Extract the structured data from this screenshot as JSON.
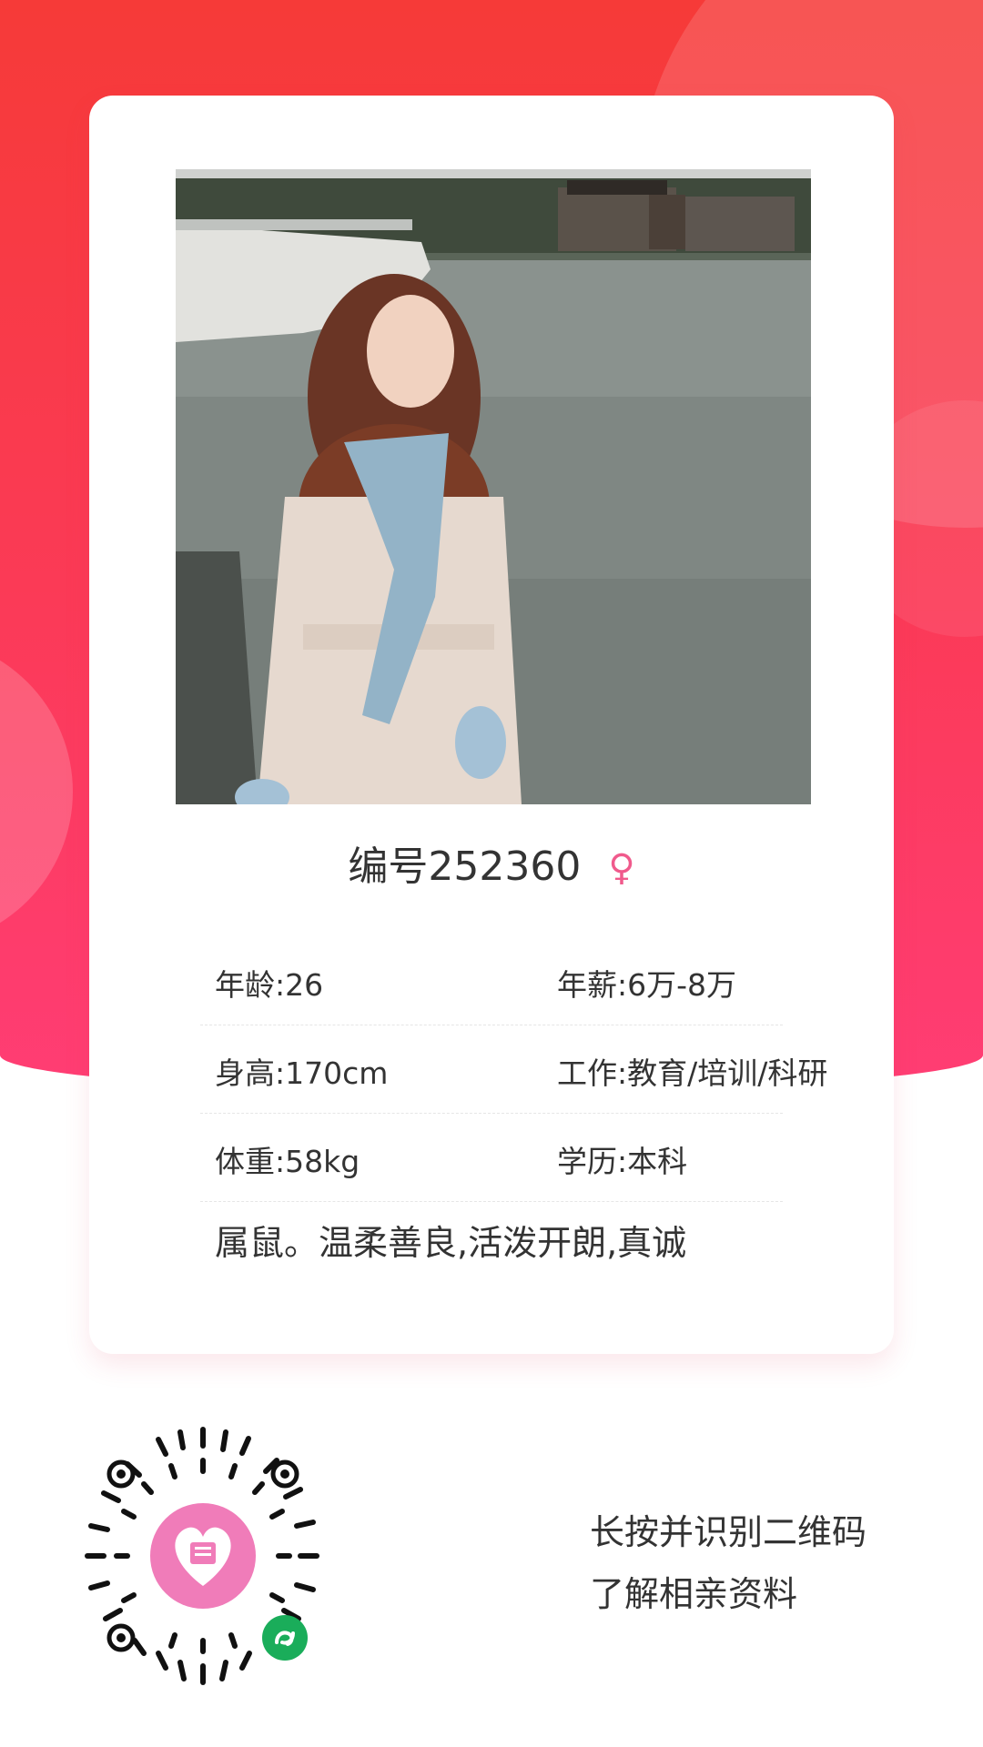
{
  "profile": {
    "title": "编号252360",
    "gender_symbol": "♀",
    "photo_label": "profile photo"
  },
  "info": {
    "rows": [
      {
        "left": "年龄:26",
        "right": "年薪:6万-8万"
      },
      {
        "left": "身高:170cm",
        "right": "工作:教育/培训/科研"
      },
      {
        "left": "体重:58kg",
        "right": "学历:本科"
      }
    ]
  },
  "description": "属鼠。温柔善良,活泼开朗,真诚",
  "cta": {
    "line1": "长按并识别二维码",
    "line2": "了解相亲资料"
  },
  "colors": {
    "hero_red": "#f63a38",
    "hero_pink": "#ff3d74",
    "gender_pink": "#f05a8c",
    "qr_logo_pink": "#f07cb9",
    "miniprogram_green": "#1aad5a"
  },
  "icons": {
    "gender": "female-symbol-icon",
    "qr_logo": "heart-logo-icon",
    "mini_program": "mini-program-icon"
  }
}
